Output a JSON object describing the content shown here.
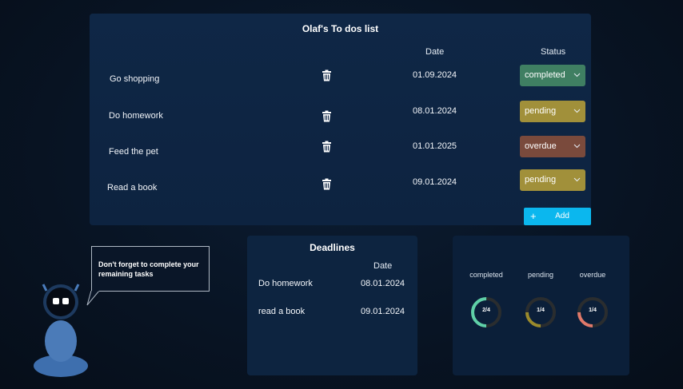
{
  "todo": {
    "title": "Olaf's To dos list",
    "col_date": "Date",
    "col_status": "Status",
    "rows": [
      {
        "task": "Go shopping",
        "date": "01.09.2024",
        "status": "completed"
      },
      {
        "task": "Do homework",
        "date": "08.01.2024",
        "status": "pending"
      },
      {
        "task": "Feed the pet",
        "date": "01.01.2025",
        "status": "overdue"
      },
      {
        "task": "Read a book",
        "date": "09.01.2024",
        "status": "pending"
      }
    ],
    "add_label": "Add",
    "add_icon": "plus-icon",
    "delete_icon": "trash-icon"
  },
  "deadlines": {
    "title": "Deadlines",
    "col_date": "Date",
    "items": [
      {
        "task": "Do homework",
        "date": "08.01.2024"
      },
      {
        "task": "read a book",
        "date": "09.01.2024"
      }
    ]
  },
  "stats": [
    {
      "label": "completed",
      "value": "2/4",
      "fraction": 0.5,
      "color": "#5fd0a8"
    },
    {
      "label": "pending",
      "value": "1/4",
      "fraction": 0.25,
      "color": "#9a8a2c"
    },
    {
      "label": "overdue",
      "value": "1/4",
      "fraction": 0.25,
      "color": "#e0796a"
    }
  ],
  "assistant": {
    "message": "Don't forget to complete your remaining tasks",
    "icon": "robot-icon"
  },
  "colors": {
    "completed": "#3f7f62",
    "pending": "#a1903a",
    "overdue": "#7a4a3c",
    "accent": "#0bb7ee"
  }
}
